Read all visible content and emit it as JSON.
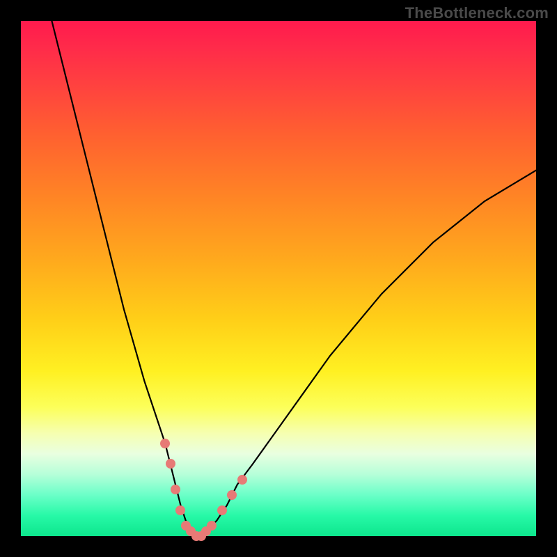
{
  "watermark": "TheBottleneck.com",
  "chart_data": {
    "type": "line",
    "title": "",
    "xlabel": "",
    "ylabel": "",
    "xlim": [
      0,
      100
    ],
    "ylim": [
      0,
      100
    ],
    "grid": false,
    "legend": false,
    "background_gradient": {
      "top_color": "#ff1a4d",
      "bottom_color": "#0de68d",
      "stops": [
        "red",
        "orange",
        "yellow",
        "green"
      ]
    },
    "series": [
      {
        "name": "bottleneck-curve",
        "color": "#000000",
        "x": [
          6,
          8,
          10,
          12,
          14,
          16,
          18,
          20,
          22,
          24,
          26,
          27,
          28,
          29,
          30,
          31,
          32,
          33,
          34,
          35,
          36,
          38,
          40,
          42,
          45,
          50,
          55,
          60,
          65,
          70,
          75,
          80,
          85,
          90,
          95,
          100
        ],
        "y": [
          100,
          92,
          84,
          76,
          68,
          60,
          52,
          44,
          37,
          30,
          24,
          21,
          18,
          14,
          10,
          6,
          3,
          1,
          0,
          0,
          1,
          3,
          6,
          10,
          14,
          21,
          28,
          35,
          41,
          47,
          52,
          57,
          61,
          65,
          68,
          71
        ]
      }
    ],
    "markers": [
      {
        "name": "left-upper-marker",
        "x": 28,
        "y": 18,
        "color": "#e77a76"
      },
      {
        "name": "left-mid-marker",
        "x": 29,
        "y": 14,
        "color": "#e77a76"
      },
      {
        "name": "left-low-marker",
        "x": 30,
        "y": 9,
        "color": "#e77a76"
      },
      {
        "name": "left-floor-marker",
        "x": 31,
        "y": 5,
        "color": "#e77a76"
      },
      {
        "name": "trough-1",
        "x": 32,
        "y": 2,
        "color": "#e77a76"
      },
      {
        "name": "trough-2",
        "x": 33,
        "y": 1,
        "color": "#e77a76"
      },
      {
        "name": "trough-3",
        "x": 34,
        "y": 0,
        "color": "#e77a76"
      },
      {
        "name": "trough-4",
        "x": 35,
        "y": 0,
        "color": "#e77a76"
      },
      {
        "name": "trough-5",
        "x": 36,
        "y": 1,
        "color": "#e77a76"
      },
      {
        "name": "trough-6",
        "x": 37,
        "y": 2,
        "color": "#e77a76"
      },
      {
        "name": "right-low-marker",
        "x": 39,
        "y": 5,
        "color": "#e77a76"
      },
      {
        "name": "right-mid-marker",
        "x": 41,
        "y": 8,
        "color": "#e77a76"
      },
      {
        "name": "right-upper-marker",
        "x": 43,
        "y": 11,
        "color": "#e77a76"
      }
    ]
  }
}
